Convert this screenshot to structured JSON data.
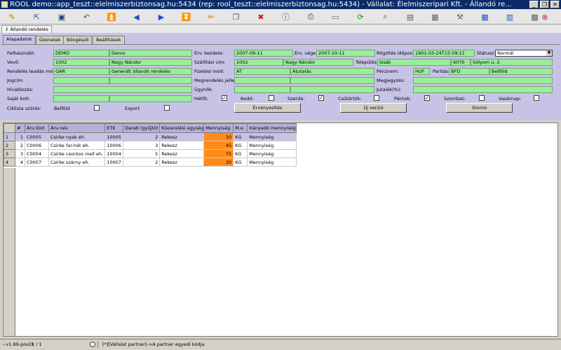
{
  "window": {
    "title": "ROOL demo::app_teszt::elelmiszerbiztonsag.hu:5434 (rep: rool_teszt::elelmiszerbiztonsag.hu:5434) - Vállalat: Élelmiszeripari Kft. - Állandó re...",
    "controls": {
      "minimize": "_",
      "restore": "❐",
      "close": "✕"
    }
  },
  "toolbar": {
    "icons": [
      {
        "name": "edit-icon",
        "glyph": "✎",
        "color": "#c08000"
      },
      {
        "name": "open-icon",
        "glyph": "⇱",
        "color": "#2060c0"
      },
      {
        "name": "save-icon",
        "glyph": "▣",
        "color": "#204080"
      },
      {
        "name": "undo-icon",
        "glyph": "↶",
        "color": "#208020"
      },
      {
        "name": "first-record-icon",
        "glyph": "⏫",
        "color": "#2050d0"
      },
      {
        "name": "prev-record-icon",
        "glyph": "◀",
        "color": "#2050d0"
      },
      {
        "name": "next-record-icon",
        "glyph": "▶",
        "color": "#2050d0"
      },
      {
        "name": "last-record-icon",
        "glyph": "⏬",
        "color": "#2050d0"
      },
      {
        "name": "pencil-icon",
        "glyph": "✏",
        "color": "#d08000"
      },
      {
        "name": "copy-icon",
        "glyph": "❐",
        "color": "#406080"
      },
      {
        "name": "delete-icon",
        "glyph": "✖",
        "color": "#c02020"
      },
      {
        "name": "info-icon",
        "glyph": "ⓘ",
        "color": "#2050d0"
      },
      {
        "name": "print-icon",
        "glyph": "⎙",
        "color": "#404040"
      },
      {
        "name": "window-icon",
        "glyph": "▭",
        "color": "#606060"
      },
      {
        "name": "refresh-icon",
        "glyph": "⟳",
        "color": "#209020"
      },
      {
        "name": "search-icon",
        "glyph": "⌕",
        "color": "#404040"
      },
      {
        "name": "document-icon",
        "glyph": "▤",
        "color": "#606060"
      },
      {
        "name": "report-icon",
        "glyph": "▦",
        "color": "#606060"
      },
      {
        "name": "tools-icon",
        "glyph": "⚒",
        "color": "#806040"
      },
      {
        "name": "table-icon",
        "glyph": "▦",
        "color": "#2050d0"
      },
      {
        "name": "columns-icon",
        "glyph": "▥",
        "color": "#2050d0"
      },
      {
        "name": "layout-icon",
        "glyph": "▩",
        "color": "#606060"
      },
      {
        "name": "exit-icon",
        "glyph": "⊗",
        "color": "#d02020"
      }
    ]
  },
  "doc_tab": {
    "label": "Állandó rendelés"
  },
  "tabs": [
    "Alapadatok",
    "Üzenetek",
    "Böngésző",
    "Beállítások"
  ],
  "form": {
    "felhasznalo": {
      "label": "Felhasználó:",
      "code": "DEMO",
      "name": "Demo"
    },
    "vevo": {
      "label": "Vevő:",
      "code": "1002",
      "name": "Nagy Nándor"
    },
    "rendeles_mod": {
      "label": "Rendelés leadás mód:",
      "code": "GAR",
      "name": "Generált állandó rendelés"
    },
    "jogcim": {
      "label": "Jogcím:"
    },
    "hivatkozas": {
      "label": "Hivatkozás:"
    },
    "sajat_bolt": {
      "label": "Saját bolt:"
    },
    "erv_kezdete": {
      "label": "Érv. kezdete:",
      "value": "2007-09-11"
    },
    "erv_vege": {
      "label": "Érv. vége:",
      "value": "2007-10-11"
    },
    "rogzites": {
      "label": "Rögzítés időpont:",
      "value": "1901-03-24T15:09:11"
    },
    "statusz": {
      "label": "Státusz:",
      "value": "Normál"
    },
    "szallitasi_cim": {
      "label": "Szállítási cím:",
      "code": "1002",
      "name": "Nagy Nándor"
    },
    "telepules": {
      "label": "Település:",
      "value": "Izsák",
      "zip": "6070",
      "street": "Sólyom u. 2."
    },
    "fizetesi_mod": {
      "label": "Fizetési mód:",
      "code": "AT",
      "name": "Átutalás"
    },
    "penznem": {
      "label": "Pénznem:",
      "value": "HUF"
    },
    "paritas": {
      "label": "Paritás:",
      "code": "BFD",
      "name": "Belföld"
    },
    "megrendeles_jelleg": {
      "label": "Megrendelés jelleg:"
    },
    "megjegyzes": {
      "label": "Megjegyzés:"
    },
    "ugynok": {
      "label": "Ügynök:"
    },
    "jutalek": {
      "label": "Jutalék(%):"
    },
    "ciklista": {
      "label": "Ciklista szűrés:",
      "belfold": "Belföld",
      "export": "Export"
    },
    "days": [
      {
        "label": "Hétfő:",
        "checked": true
      },
      {
        "label": "Kedd:",
        "checked": false
      },
      {
        "label": "Szerda:",
        "checked": true
      },
      {
        "label": "Csütörtök:",
        "checked": false
      },
      {
        "label": "Péntek:",
        "checked": true
      },
      {
        "label": "Szombat:",
        "checked": false
      },
      {
        "label": "Vasárnap:",
        "checked": false
      }
    ],
    "buttons": {
      "ervenyesites": "Érvényesítés",
      "uj_verzio": "Új verzió",
      "storno": "Stornó"
    }
  },
  "grid": {
    "columns": [
      "#",
      "Áru kód",
      "Áru név",
      "ETK",
      "Darab (gyűjtő)",
      "Kiszerelési egység",
      "Mennyiség",
      "M.e.",
      "Irányadó mennyiség"
    ],
    "rows": [
      {
        "rh": "1",
        "n": "1",
        "code": "C0005",
        "name": "Csirke nyak eh.",
        "etk": "10005",
        "darab": "2",
        "unit": "Rekesz",
        "qty": "30",
        "me": "KG",
        "irany": "Mennyiség"
      },
      {
        "rh": "2",
        "n": "2",
        "code": "C0006",
        "name": "Csirke far-hát eh.",
        "etk": "10006",
        "darab": "3",
        "unit": "Rekesz",
        "qty": "45",
        "me": "KG",
        "irany": "Mennyiség"
      },
      {
        "rh": "3",
        "n": "3",
        "code": "C0004",
        "name": "Csirke csontos mell eh.",
        "etk": "10004",
        "darab": "5",
        "unit": "Rekesz",
        "qty": "75",
        "me": "KG",
        "irany": "Mennyiség"
      },
      {
        "rh": "4",
        "n": "4",
        "code": "C0007",
        "name": "Csirke szárny eh.",
        "etk": "10007",
        "darab": "2",
        "unit": "Rekesz",
        "qty": "30",
        "me": "KG",
        "irany": "Mennyiség"
      }
    ]
  },
  "status": {
    "version": "~v1.89-pre2X",
    "record": "1 / 1",
    "hint": "[*][Vállalat partner]->A partner egyedi kódja"
  },
  "colors": {
    "accent_field": "#99ee99",
    "panel": "#c6c3e6",
    "quantity": "#ff8c1a",
    "titlebar": "#0a2a6a"
  }
}
